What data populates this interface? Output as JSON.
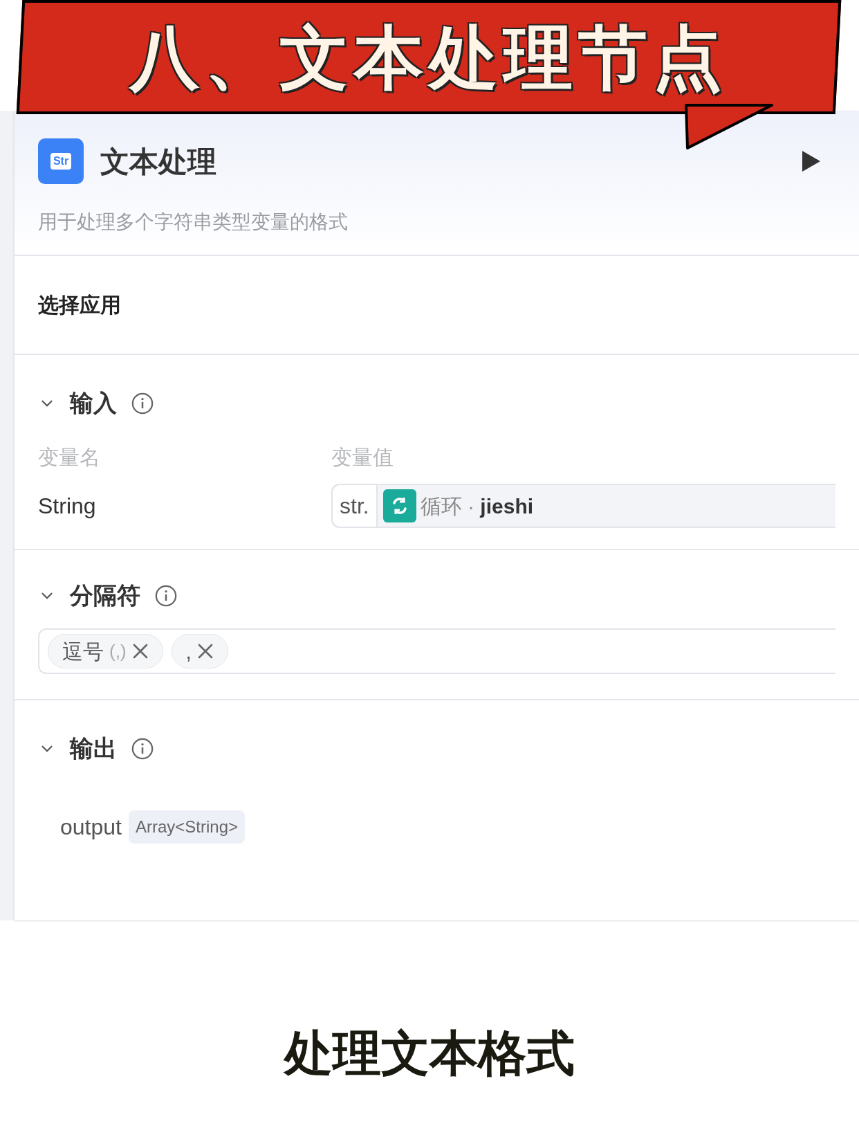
{
  "banner": {
    "title": "八、文本处理节点"
  },
  "node": {
    "title": "文本处理",
    "icon_text": "Str",
    "description": "用于处理多个字符串类型变量的格式",
    "select_app": "选择应用",
    "input": {
      "title": "输入",
      "expanded": true,
      "col_name": "变量名",
      "col_value": "变量值",
      "rows": [
        {
          "name": "String",
          "type": "str.",
          "source": "循环",
          "separator": "·",
          "variable": "jieshi"
        }
      ]
    },
    "separator": {
      "title": "分隔符",
      "expanded": true,
      "tags": [
        {
          "label": "逗号",
          "hint": "(,)"
        },
        {
          "label": ","
        }
      ]
    },
    "output": {
      "title": "输出",
      "expanded": true,
      "fields": [
        {
          "name": "output",
          "type": "Array<String>"
        }
      ]
    }
  },
  "caption": "处理文本格式"
}
